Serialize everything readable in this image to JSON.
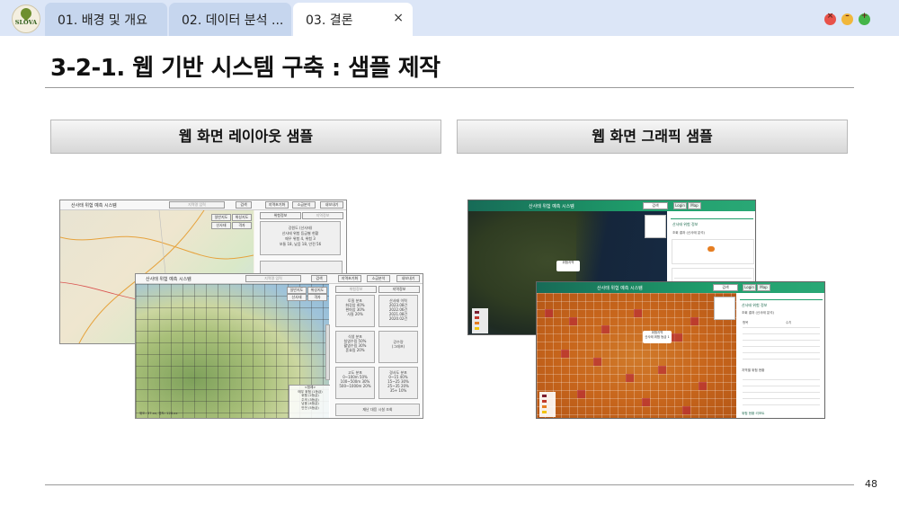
{
  "logo_text": "SLOVA",
  "tabs": [
    {
      "label": "01. 배경 및 개요"
    },
    {
      "label": "02. 데이터 분석 ..."
    },
    {
      "label": "03. 결론",
      "close": "×"
    }
  ],
  "window_controls": {
    "close": "×",
    "minimize": "–",
    "maximize": "+"
  },
  "slide": {
    "title": "3-2-1. 웹 기반 시스템 구축 : 샘플 제작",
    "left_header": "웹 화면 레이아웃 샘플",
    "right_header": "웹 화면 그래픽 샘플",
    "page_number": "48"
  },
  "layout_sample": {
    "app_title": "산사태 위험 예측 시스템",
    "search_placeholder": "지역명 입력",
    "search_btn": "검색",
    "btn_region": "지역초기화",
    "btn_print": "소급분석",
    "btn_export": "내보내기",
    "tab_risk": "위험정보",
    "tab_region": "지역정보",
    "map_type_1": "일반지도",
    "map_type_2": "위성지도",
    "map_type_3": "산사태",
    "map_type_4": "격자",
    "panel_1": "강원도 (산사태)",
    "panel_2": "산사태 위험 등급별 현황",
    "panel_3": "매우 위험 4, 위험 3",
    "panel_4": "보통 18, 낮음 18, 안전 56",
    "box_a_title": "토질 분포",
    "box_a_lines": [
      "화강암 40%",
      "편마암 30%",
      "사질 20%"
    ],
    "box_b_title": "산사태 이력",
    "box_b_lines": [
      "2023.08건",
      "2022.06건",
      "2021.08건",
      "2020.02건"
    ],
    "box_c_title": "식생 분포",
    "box_c_lines": [
      "침엽수림 50%",
      "활엽수림 30%",
      "혼효림 20%"
    ],
    "box_d_title": "강수량",
    "box_d_lines": [
      "(그래프)"
    ],
    "box_e_title": "고도 분포",
    "box_e_lines": [
      "0~100m 50%",
      "100~500m 30%",
      "500~1000m 20%"
    ],
    "box_f_title": "경사도 분포",
    "box_f_lines": [
      "0~15 40%",
      "15~25 30%",
      "25~35 20%",
      "35+ 10%"
    ],
    "box_g": "재난 대응 시설 조회",
    "legend_title": "<범례>",
    "legend_lines": [
      "매우 위험 (1등급)",
      "위험 (2등급)",
      "주의 (3등급)",
      "낮음 (4등급)",
      "안전 (5등급)"
    ],
    "coord": "위도: 37.xx, 경도: 128.xx"
  },
  "graphic_sample": {
    "app_title": "산사태 위험 예측 시스템",
    "search_value": "검색",
    "btn_login": "Login",
    "btn_map": "Map",
    "panel_title": "산사태 위험 정보",
    "status_line": "조회 결과 (산사태 분석)",
    "popup_title": "위험지역",
    "popup_line": "산사태 위험 등급 1",
    "table_header_1": "항목",
    "table_header_2": "수치",
    "section_2": "지역별 위험 현황",
    "footer_link": "위험 현황 리포트"
  },
  "colors": {
    "tabbar_bg": "#dce6f7",
    "tab_inactive": "#c6d6ee",
    "app_header_green": "#1f9e6b",
    "risk_cell": "#b41e3c",
    "heatmap_orange": "#c8661c"
  }
}
